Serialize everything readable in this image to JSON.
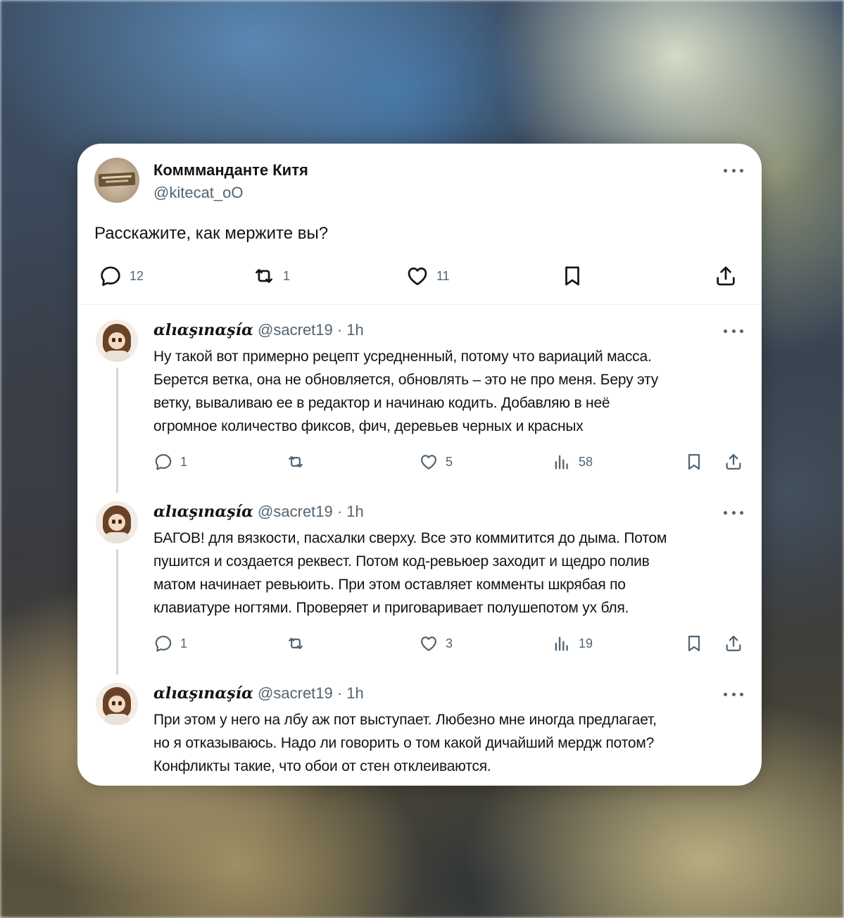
{
  "main_tweet": {
    "author_name": "Коммманданте Китя",
    "author_handle": "@kitecat_oO",
    "text": "Расскажите, как мержите вы?",
    "replies_count": "12",
    "retweets_count": "1",
    "likes_count": "11"
  },
  "replies": [
    {
      "author_name": "ɑlıɑşınɑşíɑ",
      "meta": "@sacret19 · 1h",
      "lines": [
        "Ну такой вот примерно рецепт усредненный, потому что вариаций масса.",
        "Берется ветка, она не обновляется, обновлять – это не про меня. Беру эту",
        "ветку, вываливаю ее в редактор и начинаю кодить. Добавляю в неё",
        "огромное количество фиксов, фич, деревьев черных и красных"
      ],
      "replies_count": "1",
      "likes_count": "5",
      "views_count": "58"
    },
    {
      "author_name": "ɑlıɑşınɑşíɑ",
      "meta": "@sacret19 · 1h",
      "lines": [
        "БАГОВ! для вязкости, пасхалки сверху. Все это коммитится до дыма. Потом",
        "пушится и создается реквест. Потом код-ревьюер заходит и щедро полив",
        "матом начинает ревьюить. При этом оставляет комменты шкрябая по",
        "клавиатуре ногтями. Проверяет и приговаривает полушепотом ух бля."
      ],
      "replies_count": "1",
      "likes_count": "3",
      "views_count": "19"
    },
    {
      "author_name": "ɑlıɑşınɑşíɑ",
      "meta": "@sacret19 · 1h",
      "lines": [
        "При этом у него на лбу аж пот выступает. Любезно мне иногда предлагает,",
        "но я отказываюсь. Надо ли говорить о том какой дичайший мердж потом?",
        "Конфликты такие, что обои от стен отклеиваются."
      ]
    }
  ],
  "icons": {
    "reply": "speech-bubble",
    "retweet": "repost-arrows",
    "like": "heart",
    "views": "bar-chart",
    "bookmark": "bookmark",
    "share": "upload-arrow",
    "more": "three-dots"
  },
  "colors": {
    "text_primary": "#0f1419",
    "text_secondary": "#536471",
    "card_background": "#ffffff",
    "thread_line": "#cfd9de"
  }
}
